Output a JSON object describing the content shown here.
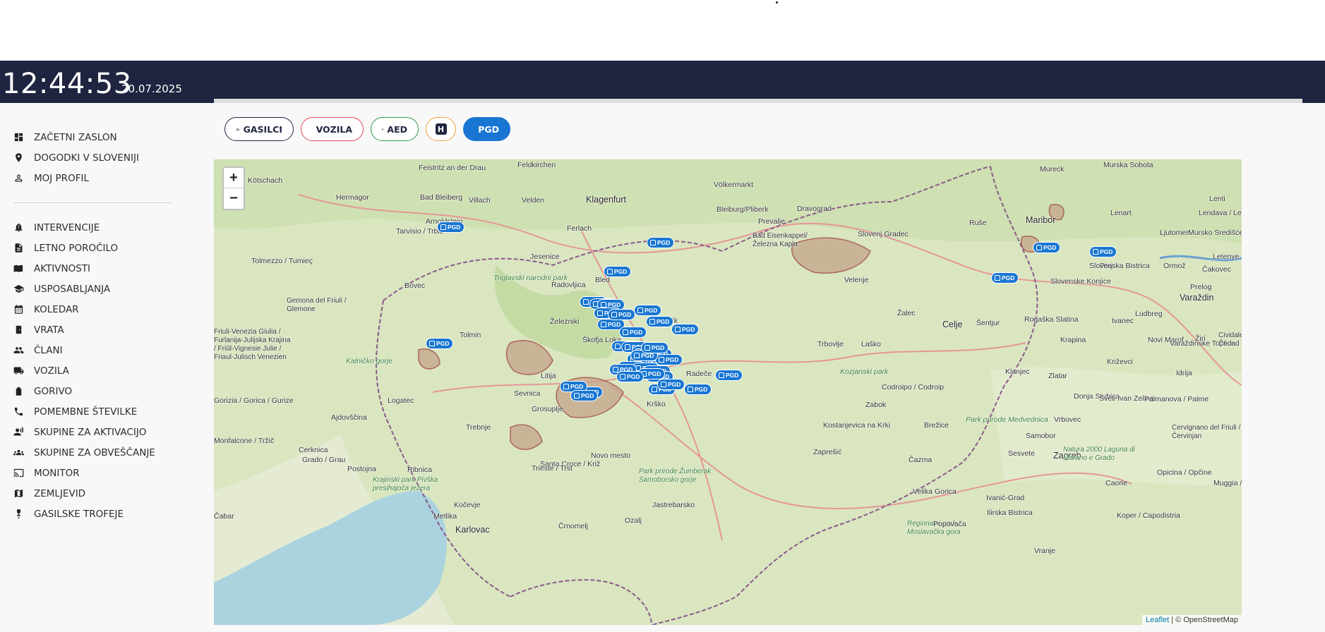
{
  "header": {
    "time": "12:44:53",
    "date": "20.07.2025"
  },
  "sidebar": {
    "primary": [
      {
        "label": "ZAČETNI ZASLON",
        "icon": "dashboard-icon"
      },
      {
        "label": "DOGODKI V SLOVENIJI",
        "icon": "location-pin-icon"
      },
      {
        "label": "MOJ PROFIL",
        "icon": "person-icon"
      }
    ],
    "secondary": [
      {
        "label": "INTERVENCIJE",
        "icon": "alarm-bell-icon"
      },
      {
        "label": "LETNO POROČILO",
        "icon": "document-icon"
      },
      {
        "label": "AKTIVNOSTI",
        "icon": "book-icon"
      },
      {
        "label": "USPOSABLJANJA",
        "icon": "graduation-cap-icon"
      },
      {
        "label": "KOLEDAR",
        "icon": "calendar-icon"
      },
      {
        "label": "VRATA",
        "icon": "door-icon"
      },
      {
        "label": "ČLANI",
        "icon": "people-icon"
      },
      {
        "label": "VOZILA",
        "icon": "truck-icon"
      },
      {
        "label": "GORIVO",
        "icon": "fuel-icon"
      },
      {
        "label": "POMEMBNE ŠTEVILKE",
        "icon": "phone-icon"
      },
      {
        "label": "SKUPINE ZA AKTIVACIJO",
        "icon": "group-activation-icon"
      },
      {
        "label": "SKUPINE ZA OBVEŠČANJE",
        "icon": "group-notify-icon"
      },
      {
        "label": "MONITOR",
        "icon": "monitor-icon"
      },
      {
        "label": "ZEMLJEVID",
        "icon": "map-icon"
      },
      {
        "label": "GASILSKE TROFEJE",
        "icon": "trophy-icon"
      }
    ]
  },
  "filters": {
    "gasilci": "GASILCI",
    "vozila": "VOZILA",
    "aed": "AED",
    "h": "H",
    "pgd": "PGD"
  },
  "map": {
    "attribution_leaflet": "Leaflet",
    "attribution_rest": "| © OpenStreetMap",
    "marker_label": "PGD",
    "places": [
      "Kötschach",
      "Feistritz an der Drau",
      "Feldkirchen",
      "Hermagor",
      "Bad Bleiberg",
      "Villach",
      "Velden",
      "Klagenfurt",
      "Völkermarkt",
      "Mureck",
      "Murska Sobota",
      "Lenti",
      "Arnoldstein",
      "Tarvisio / Trbiž",
      "Ferlach",
      "Bleiburg/Pliberk",
      "Dravograd",
      "Prevalje",
      "Bad Eisenkappel/ Železna Kapla",
      "Slovenj Gradec",
      "Ruše",
      "Maribor",
      "Lenart",
      "Ljutomer",
      "Mursko Središće",
      "Lendava / Lendva",
      "Letenye",
      "Tolmezzo / Tumieç",
      "Jesenice",
      "Radovljica",
      "Bled",
      "Bovec",
      "Triglavski narodni park",
      "Ptuj",
      "Ormož",
      "Slovenska Bistrica",
      "Slovenske Konjice",
      "Čakovec",
      "Velenje",
      "Gemona del Friuli / Glemone",
      "Varaždin",
      "Prelog",
      "Kamnik",
      "Žalec",
      "Celje",
      "Šentjur",
      "Rogaška Slatina",
      "Ivanec",
      "Ludbreg",
      "Železniki",
      "Friuli-Venezia Giulia / Furlanija-Julijska Krajina / Friûl-Vignesie Julie / Friaul-Julisch Venezien",
      "Tolmin",
      "Škofja Loka",
      "Trbovlje",
      "Laško",
      "Krapina",
      "Novi Marof",
      "Varaždinske Toplice",
      "Cividale del Friuli / Čedad",
      "Kalničko gorje",
      "Žiri",
      "Litija",
      "Radeče",
      "Kozjanski park",
      "Klanjec",
      "Zlatar",
      "Križevci",
      "Idrija",
      "Sevnica",
      "Codroipo / Codroip",
      "Gorizia / Gorica / Gurize",
      "Logatec",
      "Grosuplje",
      "Krško",
      "Zabok",
      "Donja Stubica",
      "Sveti Ivan Zelina",
      "Palmanova / Palme",
      "Ajdovščina",
      "Trebnje",
      "Kostanjevica na Krki",
      "Brežice",
      "Park prirode Medvednica",
      "Vrbovec",
      "Cervignano del Friuli / Červinjan",
      "Monfalcone / Tržič",
      "Cerknica",
      "Novo mesto",
      "Zaprešić",
      "Samobor",
      "Sesvete",
      "Zagreb",
      "Natura 2000 Laguna di Marano e Grado",
      "Grado / Grau",
      "Postojna",
      "Santa Croce / Križ",
      "Ribnica",
      "Park prirode Žumberak Samoborsko gorje",
      "Čazma",
      "Opicina / Opčine",
      "Krajinski park Pivška presihajoča jezera",
      "Trieste / Trst",
      "Kočevje",
      "Jastrebarsko",
      "Velika Gorica",
      "Ivanić-Grad",
      "Caorle",
      "Muggia / Milje",
      "Čabar",
      "Metlika",
      "Ozalj",
      "Regionalni park Moslavačka gora",
      "Ilirska Bistrica",
      "Koper / Capodistria",
      "Črnomelj",
      "Karlovac",
      "Popovača",
      "Vranje"
    ]
  }
}
